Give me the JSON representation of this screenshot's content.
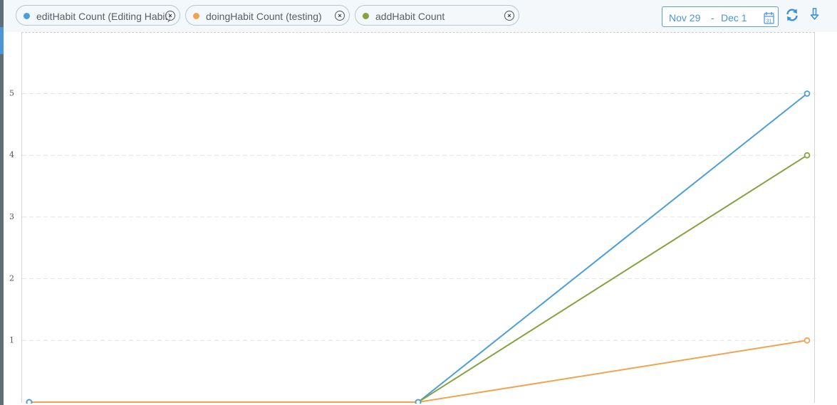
{
  "filters": {
    "chips": [
      {
        "label": "editHabit Count (Editing Habit)",
        "color": "#4a9fdb"
      },
      {
        "label": "doingHabit Count (testing)",
        "color": "#efa452"
      },
      {
        "label": "addHabit Count",
        "color": "#86a23f"
      }
    ],
    "close_glyph": "×"
  },
  "date_range": {
    "from": "Nov 29",
    "separator": "-",
    "to": "Dec 1",
    "calendar_day": "31"
  },
  "colors": {
    "accent": "#4b95d9",
    "grid": "#e2e2e2"
  },
  "icons": {
    "calendar": "calendar-icon",
    "refresh": "refresh-icon",
    "download": "download-icon"
  },
  "chart_data": {
    "type": "line",
    "x_points": 3,
    "ylim": [
      0,
      6
    ],
    "y_ticks": [
      "1",
      "2",
      "3",
      "4",
      "5"
    ],
    "grid": true,
    "series": [
      {
        "name": "editHabit Count (Editing Habit)",
        "color": "#4a9fdb",
        "values": [
          0,
          0,
          5
        ]
      },
      {
        "name": "addHabit Count",
        "color": "#86a23f",
        "values": [
          0,
          0,
          4
        ]
      },
      {
        "name": "doingHabit Count (testing)",
        "color": "#efa452",
        "values": [
          0,
          0,
          1
        ]
      }
    ]
  }
}
